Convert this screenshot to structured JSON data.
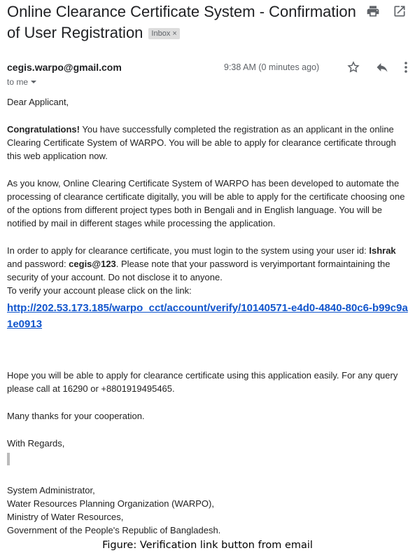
{
  "email": {
    "subject": "Online Clearance Certificate System - Confirmation of User Registration",
    "label": "Inbox",
    "label_close": "×",
    "sender": "cegis.warpo@gmail.com",
    "time": "9:38 AM (0 minutes ago)",
    "recipient": "to me",
    "icons": [
      "print-icon",
      "open-in-new-window-icon",
      "star-icon",
      "reply-icon",
      "more-options-icon",
      "dropdown-arrow-icon"
    ]
  },
  "body": {
    "greeting": "Dear Applicant,",
    "p1_bold": "Congratulations!",
    "p1_rest": " You have successfully completed the registration as an applicant in the online Clearing Certificate System of WARPO. You will be able to apply for clearance certificate through this web application now.",
    "p2": "As you know, Online Clearing Certificate System of WARPO has been developed to automate the processing of clearance certificate digitally, you will be able to apply for the certificate choosing one of the options from different project types both in Bengali and in English language. You will be notified by mail in different stages while processing the application.",
    "p3_a": "In order to apply for clearance certificate, you must login to the system using your user id: ",
    "user_id": "Ishrak",
    "p3_b": " and password: ",
    "password": "cegis@123",
    "p3_c": ". Please note that your password is veryimportant formaintaining the security of your account. Do not disclose it to anyone.",
    "verify_prompt": "To verify your account please click on the link:",
    "verify_link": "http://202.53.173.185/warpo_cct/account/verify/10140571-e4d0-4840-80c6-b99c9a1e0913",
    "p4": "Hope you will be able to apply for clearance certificate using this application easily. For any query please call at 16290 or +8801919495465.",
    "thanks": "Many thanks for your cooperation.",
    "regards": "With Regards,",
    "signature": [
      "System Administrator,",
      "Water Resources Planning Organization (WARPO),",
      "Ministry of Water Resources,",
      "Government of the People's Republic of Bangladesh."
    ]
  },
  "caption": "Figure: Verification link button from email"
}
